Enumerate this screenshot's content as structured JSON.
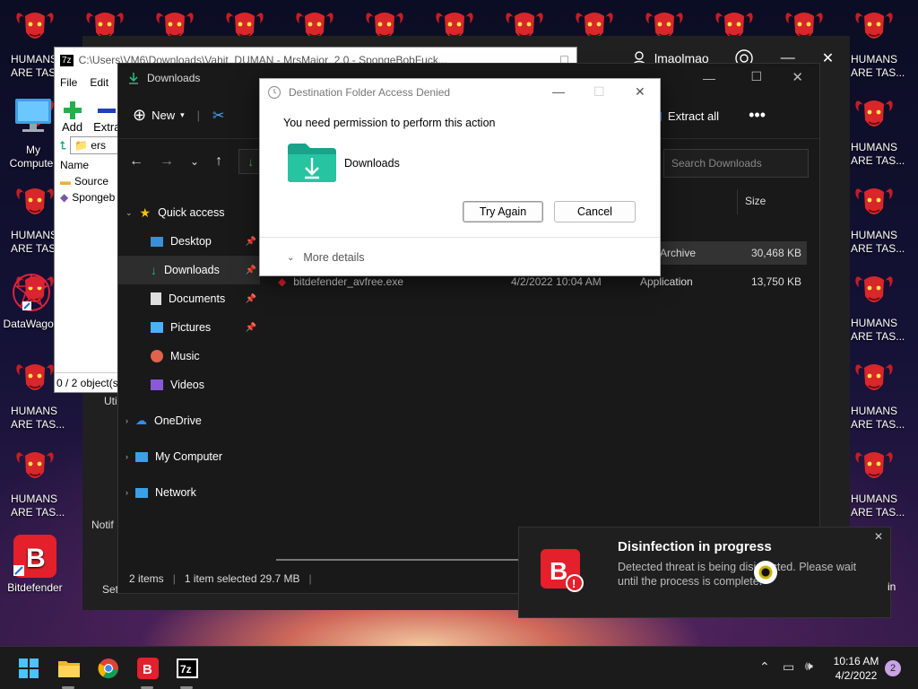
{
  "desktop": {
    "icons": [
      {
        "label": "My Computer"
      },
      {
        "label": "DataWagon"
      },
      {
        "label": "Bitdefender"
      }
    ],
    "wallpaper_caption": "HUMANS ARE TAS...",
    "wallpaper_caption_line1": "HUMANS",
    "wallpaper_caption_line2": "ARE TAS..."
  },
  "zip_window": {
    "title": "C:\\Users\\VM6\\Downloads\\Vahit_DUMAN - MrsMajor_2.0 - SpongeBobFuck...",
    "menu": [
      "File",
      "Edit"
    ],
    "toolbar": {
      "add": "Add",
      "extract": "Extra"
    },
    "address": "ers",
    "column_name": "Name",
    "items": [
      "Source",
      "Spongeb"
    ],
    "status": "0 / 2 object(s"
  },
  "settings_window": {
    "account": "lmaolmao",
    "side_labels": [
      "Uti",
      "Notif",
      "Set"
    ]
  },
  "explorer": {
    "title": "Downloads",
    "cmd_new": "New",
    "cmd_extract": "Extract all",
    "search_placeholder": "Search Downloads",
    "col_size": "Size",
    "nav": {
      "quick_access": "Quick access",
      "items": [
        {
          "label": "Desktop",
          "pinned": true
        },
        {
          "label": "Downloads",
          "pinned": true
        },
        {
          "label": "Documents",
          "pinned": true
        },
        {
          "label": "Pictures",
          "pinned": true
        },
        {
          "label": "Music",
          "pinned": false
        },
        {
          "label": "Videos",
          "pinned": false
        }
      ],
      "onedrive": "OneDrive",
      "my_computer": "My Computer",
      "network": "Network"
    },
    "files": [
      {
        "name": "",
        "date": "",
        "type": "Archive",
        "size": "30,468 KB"
      },
      {
        "name": "bitdefender_avfree.exe",
        "date": "4/2/2022 10:04 AM",
        "type": "Application",
        "size": "13,750 KB"
      }
    ],
    "status": {
      "items": "2 items",
      "selected": "1 item selected  29.7 MB"
    }
  },
  "dialog": {
    "title": "Destination Folder Access Denied",
    "message": "You need permission to perform this action",
    "folder": "Downloads",
    "try_again": "Try Again",
    "cancel": "Cancel",
    "more_details": "More details"
  },
  "toast": {
    "title": "Disinfection in progress",
    "body": "Detected threat is being disinfected. Please wait until the process is complete."
  },
  "taskbar": {
    "time": "10:16 AM",
    "date": "4/2/2022",
    "notifications": "2",
    "right_edge_text": "in"
  },
  "colors": {
    "accent_red": "#e3202b",
    "folder_teal": "#1aa38a",
    "dark_bg": "#191919"
  }
}
